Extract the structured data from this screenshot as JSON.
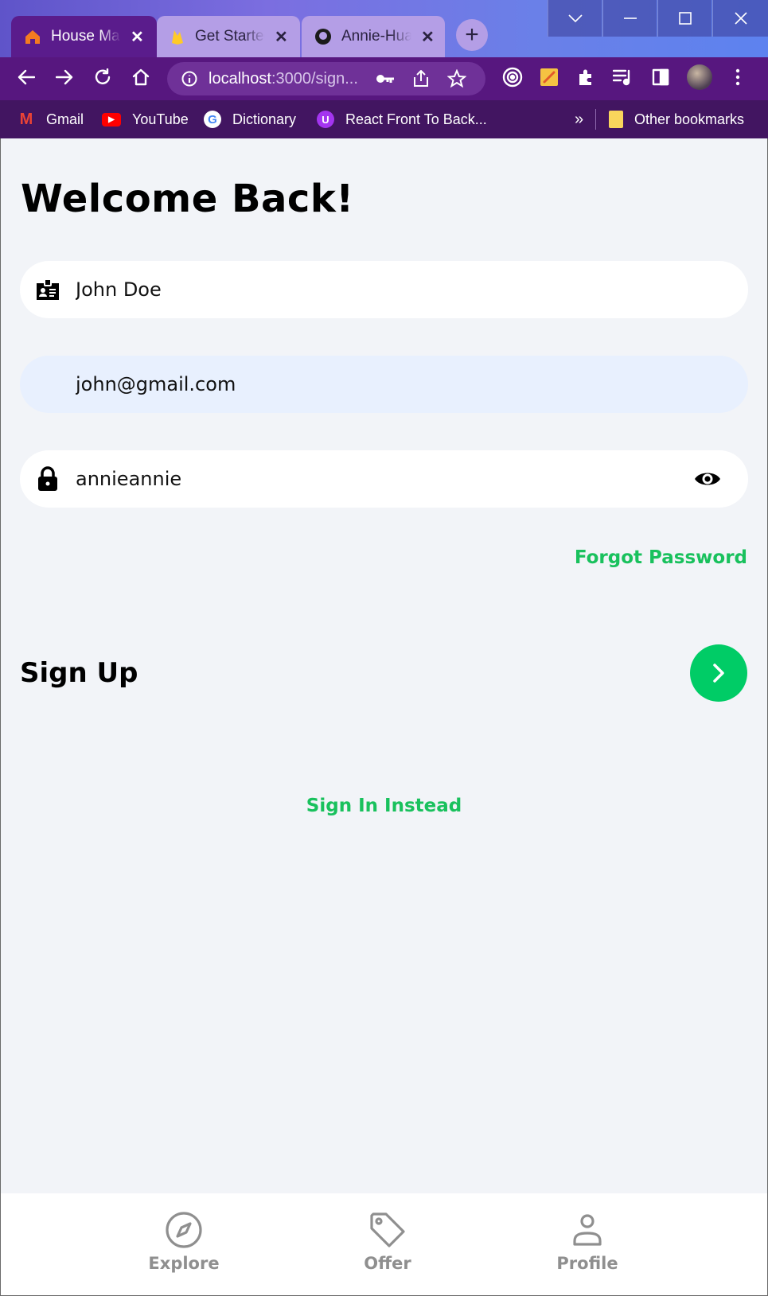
{
  "browser": {
    "tabs": [
      {
        "label": "House Marketplace",
        "active": true
      },
      {
        "label": "Get Started",
        "active": false
      },
      {
        "label": "Annie-Huang",
        "active": false
      }
    ],
    "new_tab_label": "+",
    "url": {
      "host": "localhost",
      "rest": ":3000/sign..."
    },
    "bookmarks": [
      "Gmail",
      "YouTube",
      "Dictionary",
      "React Front To Back..."
    ],
    "more_bookmarks_label": "»",
    "other_bookmarks_label": "Other bookmarks"
  },
  "page": {
    "title": "Welcome Back!",
    "name_field": {
      "value": "John Doe"
    },
    "email_field": {
      "value": "john@gmail.com"
    },
    "password_field": {
      "value": "annieannie"
    },
    "forgot_password_label": "Forgot Password",
    "sign_up_label": "Sign Up",
    "sign_in_instead_label": "Sign In Instead"
  },
  "navbar": {
    "items": [
      {
        "label": "Explore",
        "icon": "compass-icon"
      },
      {
        "label": "Offer",
        "icon": "tag-icon"
      },
      {
        "label": "Profile",
        "icon": "person-icon"
      }
    ]
  },
  "colors": {
    "accent": "#00cc66",
    "accent_text": "#19c15d",
    "background": "#f2f4f8",
    "browser_toolbar": "#57177f"
  }
}
